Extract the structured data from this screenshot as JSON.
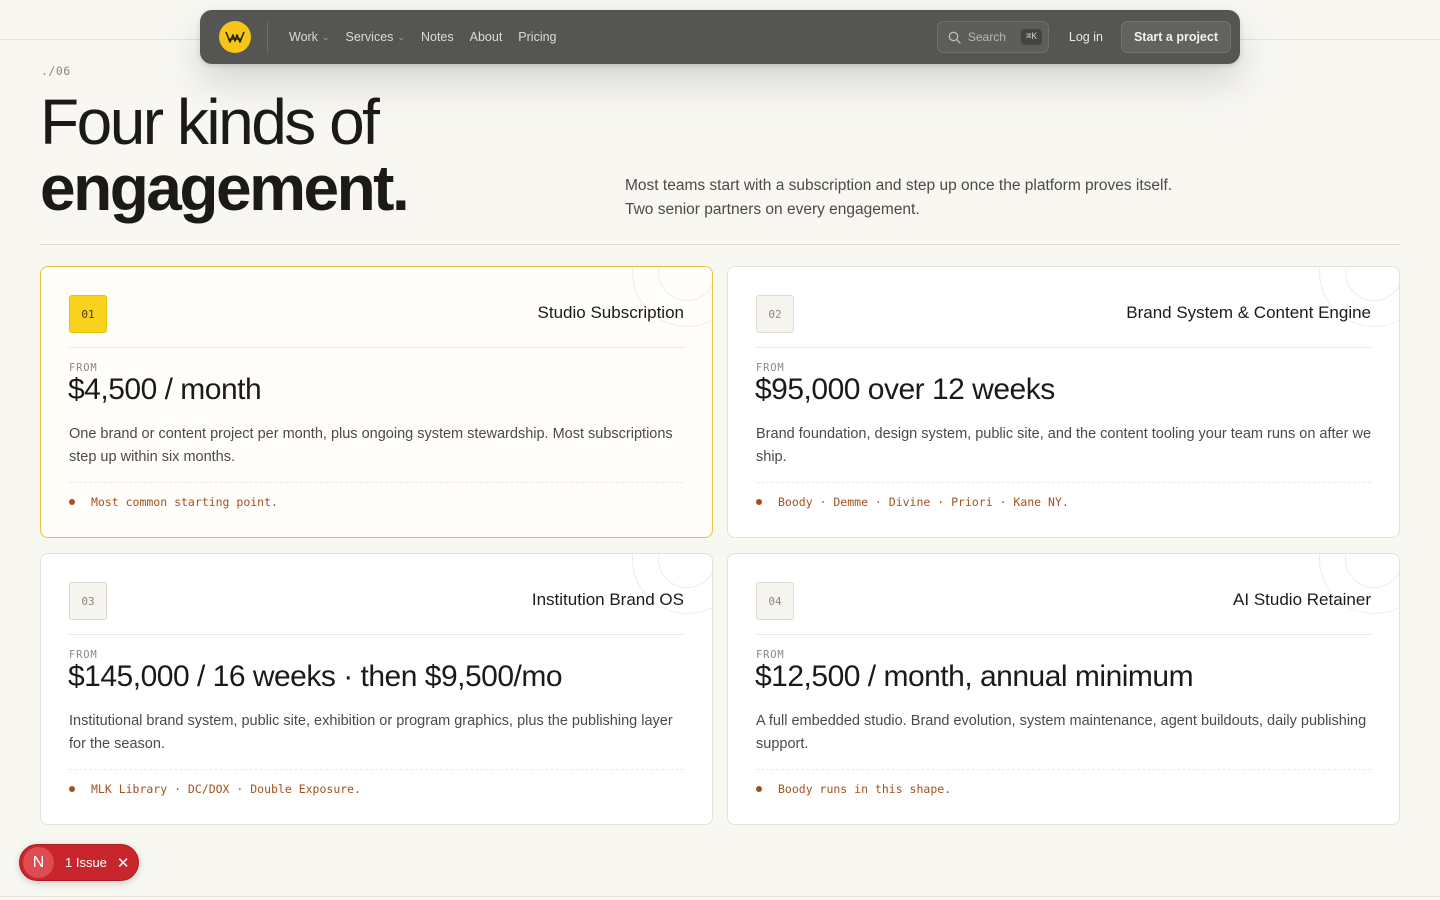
{
  "nav": {
    "links": [
      {
        "label": "Work",
        "has_menu": true
      },
      {
        "label": "Services",
        "has_menu": true
      },
      {
        "label": "Notes",
        "has_menu": false
      },
      {
        "label": "About",
        "has_menu": false
      },
      {
        "label": "Pricing",
        "has_menu": false
      }
    ],
    "search_placeholder": "Search",
    "search_shortcut": "⌘K",
    "login_label": "Log in",
    "cta_label": "Start a project"
  },
  "hero": {
    "index": "./06",
    "headline_light": "Four kinds of",
    "headline_bold": "engagement.",
    "intro": "Most teams start with a subscription and step up once the platform proves itself. Two senior partners on every engagement."
  },
  "cards": [
    {
      "num": "01",
      "title": "Studio Subscription",
      "from_label": "FROM",
      "price": "$4,500 / month",
      "desc": "One brand or content project per month, plus ongoing system stewardship. Most subscriptions step up within six months.",
      "note": "Most common starting point."
    },
    {
      "num": "02",
      "title": "Brand System & Content Engine",
      "from_label": "FROM",
      "price": "$95,000 over 12 weeks",
      "desc": "Brand foundation, design system, public site, and the content tooling your team runs on after we ship.",
      "note": "Boody · Demme · Divine · Priori · Kane NY."
    },
    {
      "num": "03",
      "title": "Institution Brand OS",
      "from_label": "FROM",
      "price": "$145,000 / 16 weeks · then $9,500/mo",
      "desc": "Institutional brand system, public site, exhibition or program graphics, plus the publishing layer for the season.",
      "note": "MLK Library · DC/DOX · Double Exposure."
    },
    {
      "num": "04",
      "title": "AI Studio Retainer",
      "from_label": "FROM",
      "price": "$12,500 / month, annual minimum",
      "desc": "A full embedded studio. Brand evolution, system maintenance, agent buildouts, daily publishing support.",
      "note": "Boody runs in this shape."
    }
  ],
  "issue_badge": {
    "initial": "N",
    "label": "1 Issue"
  },
  "colors": {
    "accent_yellow": "#f9d21e",
    "note_rust": "#a5501f",
    "nav_bg": "#555553",
    "issue_red": "#c8262c"
  }
}
